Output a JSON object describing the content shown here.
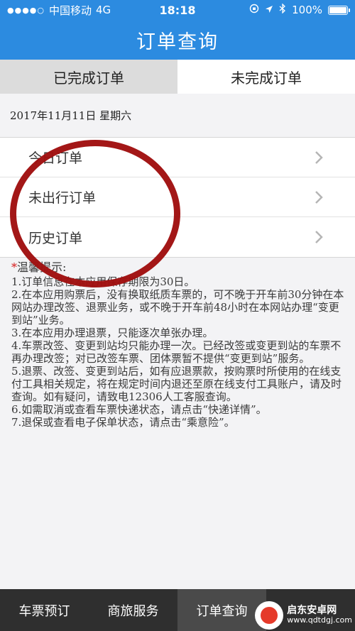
{
  "status_bar": {
    "carrier": "中国移动",
    "network": "4G",
    "time": "18:18",
    "battery": "100%"
  },
  "header": {
    "title": "订单查询"
  },
  "tabs": [
    {
      "label": "已完成订单",
      "active": true
    },
    {
      "label": "未完成订单",
      "active": false
    }
  ],
  "date_text": "2017年11月11日 星期六",
  "menu": [
    {
      "label": "今日订单"
    },
    {
      "label": "未出行订单"
    },
    {
      "label": "历史订单"
    }
  ],
  "tips": {
    "star": "*",
    "title": "温馨提示:",
    "lines": [
      "1.订单信息在本应用保存期限为30日。",
      "2.在本应用购票后，没有换取纸质车票的，可不晚于开车前30分钟在本网站办理改签、退票业务，或不晚于开车前48小时在本网站办理“变更到站”业务。",
      "3.在本应用办理退票，只能逐次单张办理。",
      "4.车票改签、变更到站均只能办理一次。已经改签或变更到站的车票不再办理改签；对已改签车票、团体票暂不提供“变更到站”服务。",
      "5.退票、改签、变更到站后，如有应退票款，按购票时所使用的在线支付工具相关规定，将在规定时间内退还至原在线支付工具账户，请及时查询。如有疑问，请致电12306人工客服查询。",
      "6.如需取消或查看车票快递状态，请点击“快递详情”。",
      "7.退保或查看电子保单状态，请点击“乘意险”。"
    ]
  },
  "bottom_tabs": [
    {
      "label": "车票预订"
    },
    {
      "label": "商旅服务"
    },
    {
      "label": "订单查询",
      "active": true
    }
  ],
  "watermark": {
    "name": "启东安卓网",
    "url": "www.qdtdgj.com"
  },
  "colors": {
    "primary": "#2c8be0",
    "annotation": "#a01010",
    "tabbar": "#2f2f2f"
  }
}
